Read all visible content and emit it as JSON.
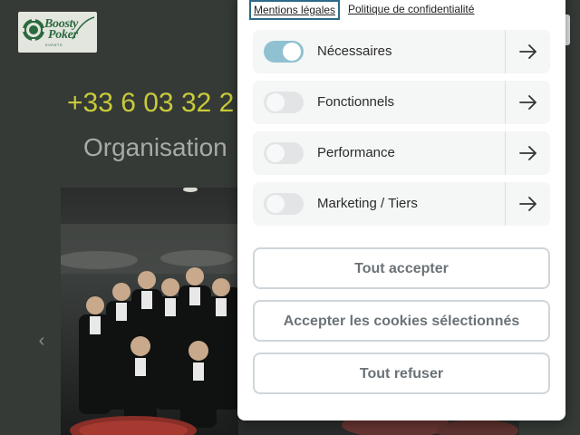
{
  "background": {
    "logo": {
      "name": "Boosty Poker",
      "line1": "Boosty",
      "line2": "Poker",
      "sub": "EVENTS"
    },
    "phone": "+33 6 03 32 2",
    "tagline": "Organisation"
  },
  "modal": {
    "links": {
      "mentions": "Mentions légales",
      "privacy": "Politique de confidentialité"
    },
    "categories": [
      {
        "label": "Nécessaires",
        "enabled": true
      },
      {
        "label": "Fonctionnels",
        "enabled": false
      },
      {
        "label": "Performance",
        "enabled": false
      },
      {
        "label": "Marketing / Tiers",
        "enabled": false
      }
    ],
    "buttons": {
      "accept_all": "Tout accepter",
      "accept_selected": "Accepter les cookies sélectionnés",
      "reject_all": "Tout refuser"
    }
  },
  "colors": {
    "phone": "#c9cb3a",
    "toggle_on": "#8fc1d1",
    "toggle_off": "#e2e4e6",
    "focus_outline": "#2d6a86"
  }
}
